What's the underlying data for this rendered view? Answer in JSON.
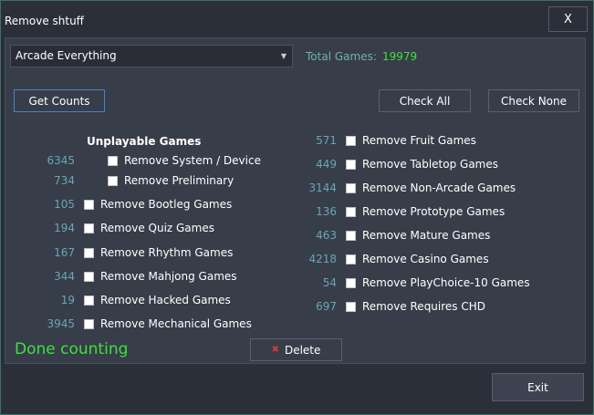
{
  "window": {
    "title": "Remove shtuff",
    "close_label": "X"
  },
  "filter": {
    "selected": "Arcade Everything"
  },
  "totals": {
    "label": "Total Games:",
    "value": "19979"
  },
  "buttons": {
    "get_counts": "Get Counts",
    "check_all": "Check All",
    "check_none": "Check None",
    "delete": "Delete",
    "exit": "Exit"
  },
  "left": {
    "header": "Unplayable Games",
    "sub_items": [
      {
        "count": "6345",
        "label": "Remove System / Device"
      },
      {
        "count": "734",
        "label": "Remove Preliminary"
      }
    ],
    "items": [
      {
        "count": "105",
        "label": "Remove Bootleg Games"
      },
      {
        "count": "194",
        "label": "Remove Quiz Games"
      },
      {
        "count": "167",
        "label": "Remove Rhythm Games"
      },
      {
        "count": "344",
        "label": "Remove Mahjong Games"
      },
      {
        "count": "19",
        "label": "Remove Hacked Games"
      },
      {
        "count": "3945",
        "label": "Remove Mechanical Games"
      }
    ]
  },
  "right": {
    "items": [
      {
        "count": "571",
        "label": "Remove Fruit Games"
      },
      {
        "count": "449",
        "label": "Remove Tabletop Games"
      },
      {
        "count": "3144",
        "label": "Remove Non-Arcade Games"
      },
      {
        "count": "136",
        "label": "Remove Prototype Games"
      },
      {
        "count": "463",
        "label": "Remove Mature Games"
      },
      {
        "count": "4218",
        "label": "Remove Casino Games"
      },
      {
        "count": "54",
        "label": "Remove PlayChoice-10 Games"
      },
      {
        "count": "697",
        "label": "Remove Requires CHD"
      }
    ]
  },
  "status": {
    "text": "Done counting"
  },
  "colors": {
    "accent_green": "#3fe03f",
    "count_teal": "#6aa6b4",
    "delete_red": "#d03a3a"
  }
}
